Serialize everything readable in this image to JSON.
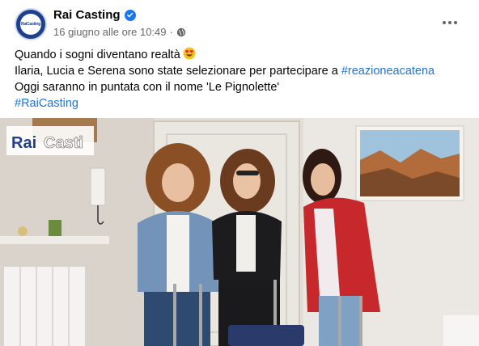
{
  "header": {
    "page_name": "Rai Casting",
    "avatar_label": "RaiCasting",
    "timestamp": "16 giugno alle ore 10:49",
    "separator": "·",
    "verified": true,
    "audience_icon": "globe-icon",
    "more_icon": "more-options-icon"
  },
  "post": {
    "line1": "Quando i sogni diventano realtà",
    "line1_emoji": "heart-eyes-emoji",
    "line2_text": "Ilaria, Lucia e Serena sono state selezionare per partecipare a ",
    "line2_hashtag": "#reazioneacatena",
    "line3": "Oggi saranno in puntata con il nome 'Le Pignolette'",
    "line4_hashtag": "#RaiCasting"
  },
  "video": {
    "watermark_prefix": "Rai",
    "watermark_suffix": "Casti",
    "description": ""
  },
  "colors": {
    "brand_blue": "#1f3f8f",
    "link_blue": "#1b74e4",
    "verified_blue": "#1877f2",
    "meta_gray": "#65676b"
  }
}
